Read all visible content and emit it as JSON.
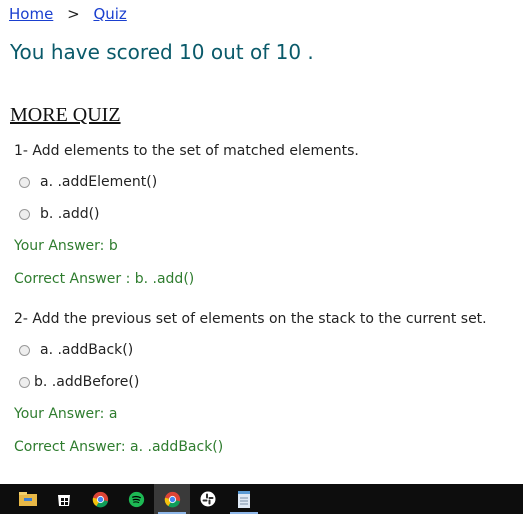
{
  "breadcrumb": {
    "home": "Home",
    "sep": ">",
    "quiz": "Quiz"
  },
  "score_text": "You have scored 10 out of 10 .",
  "section_title": "MORE QUIZ",
  "questions": [
    {
      "text": "1- Add elements to the set of matched elements.",
      "options": [
        "a. .addElement()",
        "b. .add()"
      ],
      "your_answer": "Your Answer: b",
      "correct_answer": "Correct Answer : b. .add()"
    },
    {
      "text": "2- Add the previous set of elements on the stack to the current set.",
      "options": [
        "a. .addBack()",
        "b. .addBefore()"
      ],
      "your_answer": "Your Answer: a",
      "correct_answer": "Correct Answer: a. .addBack()"
    }
  ],
  "taskbar": {
    "icons": [
      "file-explorer-icon",
      "store-icon",
      "chrome-icon",
      "spotify-icon",
      "chrome-icon",
      "slack-icon",
      "notepad-icon"
    ],
    "colors": {
      "bg": "#0d0d0d",
      "accent": "#8fb7e8"
    }
  }
}
